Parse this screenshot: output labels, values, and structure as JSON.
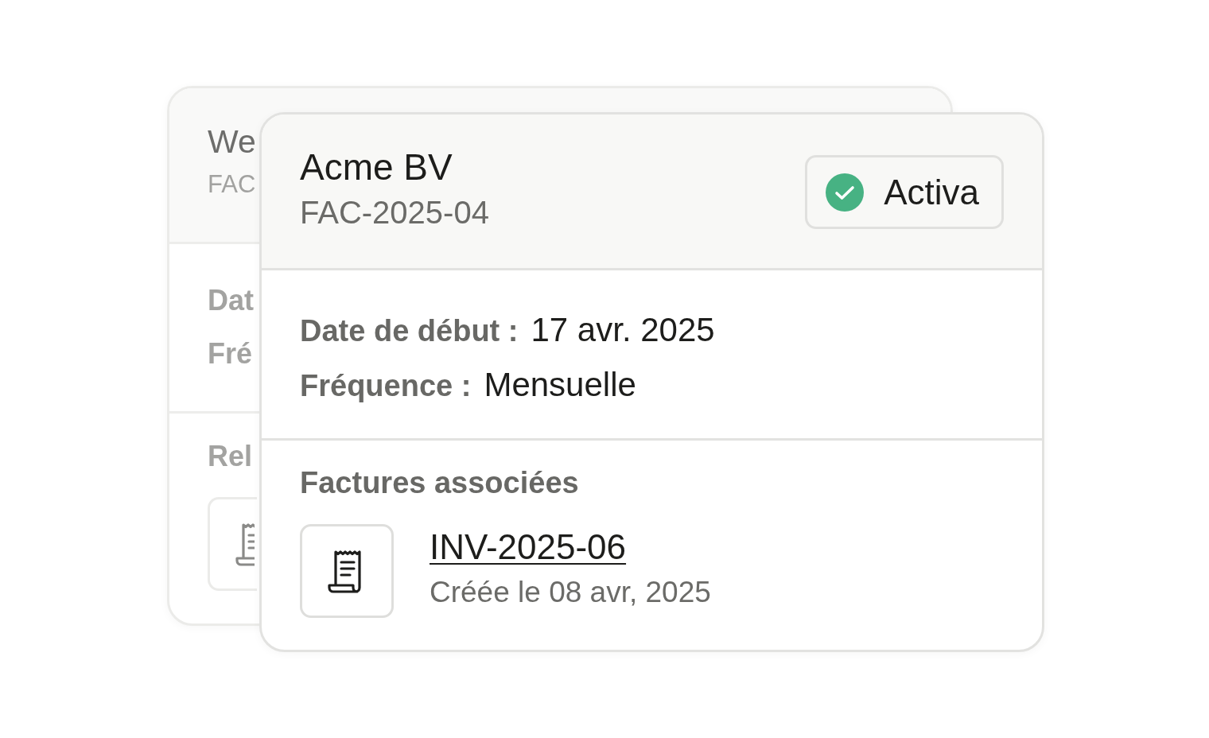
{
  "background_card": {
    "title": "We",
    "subtitle": "FAC",
    "fields": [
      {
        "label": "Dat"
      },
      {
        "label": "Fré"
      }
    ],
    "section_title": "Rel"
  },
  "card": {
    "title": "Acme BV",
    "subtitle": "FAC-2025-04",
    "status": {
      "label": "Activa",
      "kind": "active"
    },
    "fields": [
      {
        "label": "Date de début :",
        "value": "17 avr. 2025"
      },
      {
        "label": "Fréquence :",
        "value": "Mensuelle"
      }
    ],
    "related": {
      "title": "Factures associées",
      "invoices": [
        {
          "number": "INV-2025-06",
          "created": "Créée le 08 avr, 2025"
        }
      ]
    }
  }
}
